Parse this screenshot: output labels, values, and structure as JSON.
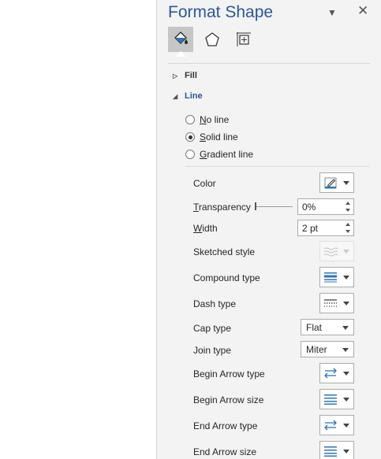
{
  "pane": {
    "title": "Format Shape",
    "options_glyph": "▼",
    "close_glyph": "✕"
  },
  "tabs": [
    {
      "icon": "fill-line-icon",
      "active": true
    },
    {
      "icon": "effects-icon",
      "active": false
    },
    {
      "icon": "size-properties-icon",
      "active": false
    }
  ],
  "sections": {
    "fill": {
      "label": "Fill",
      "expanded": false
    },
    "line": {
      "label": "Line",
      "expanded": true
    }
  },
  "line_options": {
    "no_line": {
      "label_key": "N",
      "label_rest": "o line",
      "selected": false
    },
    "solid_line": {
      "label_key": "S",
      "label_rest": "olid line",
      "selected": true
    },
    "gradient_line": {
      "label_key": "G",
      "label_rest": "radient line",
      "selected": false
    }
  },
  "properties": {
    "color": {
      "label": "Color"
    },
    "transparency": {
      "label_key": "T",
      "label_rest": "ransparency",
      "value": "0%",
      "slider_fraction": 0
    },
    "width": {
      "label_key": "W",
      "label_rest": "idth",
      "value": "2 pt"
    },
    "sketched_style": {
      "label": "Sketched style"
    },
    "compound_type": {
      "label": "Compound type"
    },
    "dash_type": {
      "label": "Dash type"
    },
    "cap_type": {
      "label": "Cap type",
      "value": "Flat"
    },
    "join_type": {
      "label": "Join type",
      "value": "Miter"
    },
    "begin_arrow_type": {
      "label": "Begin Arrow type"
    },
    "begin_arrow_size": {
      "label": "Begin Arrow size"
    },
    "end_arrow_type": {
      "label": "End Arrow type"
    },
    "end_arrow_size": {
      "label": "End Arrow size"
    }
  },
  "colors": {
    "title": "#2b579a",
    "pane_bg": "#f3f3f3",
    "accent_blue": "#2e75b6"
  }
}
